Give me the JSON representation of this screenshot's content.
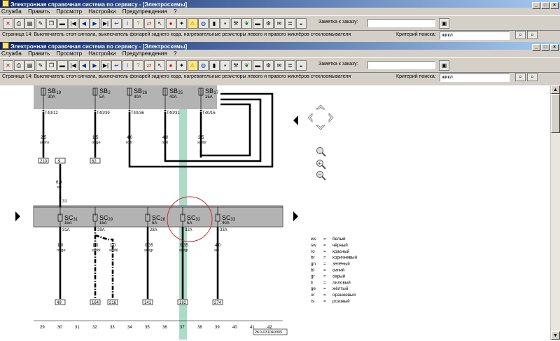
{
  "window": {
    "title": "Электронная справочная система по сервису - [Электросхемы]",
    "menu": [
      "Служба",
      "Править",
      "Просмотр",
      "Настройки",
      "Предупреждения",
      "?"
    ]
  },
  "toolbar": {
    "icons": [
      "exit-icon",
      "print-icon",
      "document-icon",
      "edit-icon",
      "copy-icon",
      "car-icon",
      "first-page-icon",
      "prev-page-icon",
      "next-page-icon",
      "last-page-icon",
      "back-icon",
      "info-icon",
      "help-icon",
      "swap-icon",
      "cursor-icon",
      "stop-icon",
      "engine-icon",
      "warning-icon",
      "globe-icon",
      "battery-icon",
      "save-icon",
      "wrench-icon",
      "leaf-icon",
      "car2-icon",
      "gear-icon",
      "mail-icon",
      "notes-icon",
      "schema-icon"
    ],
    "order_label": "Заметка к заказу:",
    "order_value": ""
  },
  "pagebar": {
    "page_text": "Страница 14: Выключатель стоп-сигнала, выключатель фонарей заднего хода, нагревательные резисторы левого и правого жиклёров стеклоомывателя",
    "search_label": "Критерий поиска:",
    "search_value": "жикл"
  },
  "diagram": {
    "top_fuses": [
      {
        "name": "SB",
        "sub": "19",
        "amp": "30A",
        "term": "T40/12",
        "wire_size": "2,5",
        "wire_color": "sw/ro",
        "ref": "210"
      },
      {
        "name": "SB",
        "sub": "2",
        "amp": "5A",
        "term": "T40/39",
        "wire_size": "1,5",
        "wire_color": "ro/ge",
        "ref": "62"
      },
      {
        "name": "SB",
        "sub": "26",
        "amp": "40A",
        "term": "T40/36",
        "wire_size": "4,0",
        "wire_color": "ro/li",
        "ref": ""
      },
      {
        "name": "SB",
        "sub": "25",
        "amp": "40A",
        "term": "T40/31",
        "wire_size": "4,0",
        "wire_color": "ro/li",
        "ref": ""
      },
      {
        "name": "SB",
        "sub": "17",
        "amp": "15A",
        "term": "T40/16",
        "wire_size": "2,5",
        "wire_color": "sw/br",
        "ref": ""
      }
    ],
    "feed_ref": "9",
    "feed_wire_size": "6,0",
    "feed_wire_color": "sw",
    "feed_terminal": "31",
    "bottom_fuses": [
      {
        "name": "SC",
        "sub": "31",
        "amp": "15A",
        "term": "31A",
        "wire_size": "1,0",
        "wire_color": "ro/ge",
        "ref": "49"
      },
      {
        "name": "SC",
        "sub": "29",
        "amp": "15A",
        "term": "29A",
        "wire_size": "1,0",
        "wire_color": "sw/bl",
        "ref": "164"
      },
      {
        "name": "SC",
        "sub": "28",
        "amp": "5A",
        "term": "28A",
        "wire_size": "0,35",
        "wire_color": "sw/gr",
        "ref": "141"
      },
      {
        "name": "SC",
        "sub": "32",
        "amp": "5A",
        "term": "32A",
        "wire_size": "0,35",
        "wire_color": "sw/gr",
        "ref": "182"
      },
      {
        "name": "SC",
        "sub": "33",
        "amp": "40A",
        "term": "33A",
        "wire_size": "4,0",
        "wire_color": "sw",
        "ref": "274"
      }
    ],
    "branch_wire": {
      "wire_size": "1,0",
      "wire_color": "sw/bl",
      "ref": "216"
    },
    "scale": [
      "29",
      "30",
      "31",
      "32",
      "33",
      "34",
      "35",
      "36",
      "37",
      "38",
      "39",
      "40",
      "41",
      "42"
    ],
    "diagram_id": "2K0-031040905",
    "legend": [
      {
        "code": "ws",
        "eq": "=",
        "text": "белый"
      },
      {
        "code": "sw",
        "eq": "=",
        "text": "чёрный"
      },
      {
        "code": "ro",
        "eq": "=",
        "text": "красный"
      },
      {
        "code": "br",
        "eq": "=",
        "text": "коричневый"
      },
      {
        "code": "gn",
        "eq": "=",
        "text": "зелёный"
      },
      {
        "code": "bl",
        "eq": "=",
        "text": "синий"
      },
      {
        "code": "gr",
        "eq": "=",
        "text": "серый"
      },
      {
        "code": "li",
        "eq": "=",
        "text": "лиловый"
      },
      {
        "code": "ge",
        "eq": "=",
        "text": "жёлтый"
      },
      {
        "code": "or",
        "eq": "=",
        "text": "оранжевый"
      },
      {
        "code": "rs",
        "eq": "=",
        "text": "розовый"
      }
    ]
  },
  "colors": {
    "titlebar_start": "#0a246a",
    "titlebar_end": "#a6caf0",
    "chrome": "#d4d0c8",
    "fuse_block": "#b3b3b3",
    "highlight": "#8fd0b4",
    "circle": "#cc2222"
  }
}
